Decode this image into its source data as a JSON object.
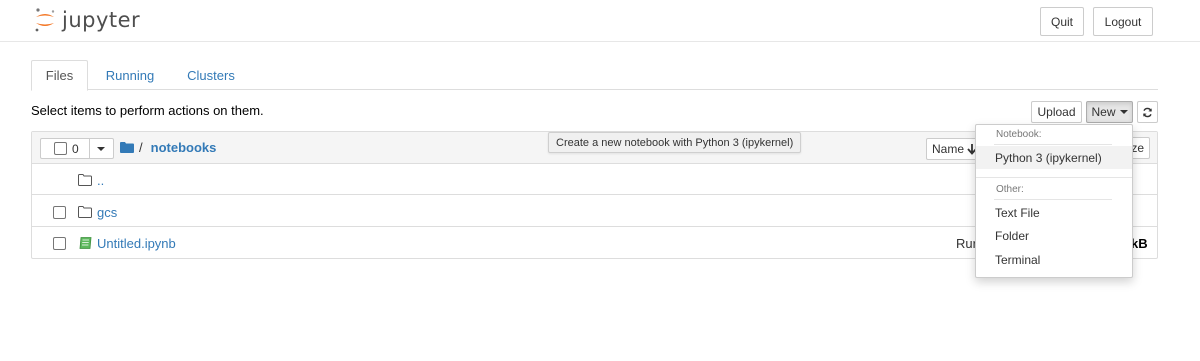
{
  "header": {
    "logo_text": "jupyter",
    "quit_label": "Quit",
    "logout_label": "Logout"
  },
  "tabs": [
    {
      "label": "Files",
      "active": true
    },
    {
      "label": "Running",
      "active": false
    },
    {
      "label": "Clusters",
      "active": false
    }
  ],
  "toolbar": {
    "instruction": "Select items to perform actions on them.",
    "upload_label": "Upload",
    "new_label": "New",
    "refresh_icon": "refresh-icon"
  },
  "list": {
    "selected_count": "0",
    "breadcrumb_root": "/",
    "breadcrumb_folder": "notebooks",
    "sort_label": "Name",
    "sort_icon": "arrow-down-icon",
    "items": [
      {
        "name": "..",
        "icon": "folder-icon"
      },
      {
        "name": "gcs",
        "icon": "folder-icon"
      },
      {
        "name": "Untitled.ipynb",
        "icon": "notebook-icon",
        "status": "Rur",
        "size": "kB"
      }
    ]
  },
  "tooltip": {
    "text": "Create a new notebook with Python 3 (ipykernel)"
  },
  "dropdown": {
    "notebook_header": "Notebook:",
    "python_kernel": "Python 3 (ipykernel)",
    "other_header": "Other:",
    "text_file": "Text File",
    "folder": "Folder",
    "terminal": "Terminal",
    "hidden_button_fragment": "ze"
  },
  "colors": {
    "link": "#337ab7",
    "accent_orange": "#f37726",
    "notebook_green": "#5cb85c"
  }
}
